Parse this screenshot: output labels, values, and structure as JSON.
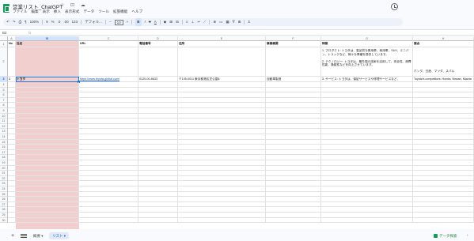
{
  "app": {
    "title": "営業リスト_ChatGPT",
    "title_icons": "☆ ⊡ ☁",
    "menus": [
      "ファイル",
      "編集",
      "表示",
      "挿入",
      "表示形式",
      "データ",
      "ツール",
      "拡張機能",
      "ヘルプ"
    ]
  },
  "toolbar": {
    "undo": "↶",
    "redo": "↷",
    "print": "⎙",
    "paint": "¶",
    "zoom": "100%",
    "currency": "¥",
    "percent": "%",
    "dec_less": ".0",
    "dec_more": ".00",
    "format_123": "123",
    "font": "デフォル...",
    "font_size_minus": "−",
    "font_size": "10",
    "font_size_plus": "+",
    "bold": "B",
    "italic": "I",
    "strike": "S",
    "text_color": "A",
    "fill": "◆",
    "borders": "⊞",
    "merge": "⊟",
    "align": "≡",
    "valign": "⊥",
    "wrap": "↩",
    "rotate": "⟋",
    "link": "⊗",
    "comment": "▭",
    "chart": "▦",
    "filter": "∇",
    "views": "⊞",
    "functions": "Σ"
  },
  "formula_bar": {
    "cell_ref": "B3",
    "fx": "fx"
  },
  "columns": [
    "",
    "A",
    "B",
    "C",
    "D",
    "E",
    "F",
    "G",
    "H"
  ],
  "rows": {
    "r1": {
      "num": "1",
      "cells": [
        "No",
        "社名",
        "URL",
        "電話番号",
        "住所",
        "事業概要",
        "特徴",
        "競合"
      ]
    },
    "r2": {
      "num": "2",
      "cells": [
        "",
        "",
        "",
        "",
        "",
        "",
        "1. プロダクト: トヨタは、高品質な乗用車、商用車、SUV、ミニバン、トラックなど、様々な車種を提供しています。\n\n2. テクノロジー: トヨタは、最先端の技術を活用して、安全性、燃費性能、操縦性などを向上させています。",
        "ホンダ、日産、マツダ、スバル"
      ]
    },
    "r3": {
      "num": "3",
      "cells": [
        "1",
        "トヨタ",
        "https://www.toyota-global.com/",
        "0120-00-8633",
        "〒105-0011 東京都港区芝公園4",
        "自動車製造",
        "3. サービス: トヨタは、保証サービスや修理サービスなど、",
        "Toyota's competitors: Honda, Nissan, Mazda"
      ]
    },
    "empty_row_nums": [
      "4",
      "5",
      "6",
      "7",
      "8",
      "9",
      "10",
      "11",
      "12",
      "13",
      "14",
      "15",
      "16",
      "17",
      "18",
      "19",
      "20",
      "21",
      "22",
      "23",
      "24",
      "25",
      "26",
      "27",
      "28",
      "29",
      "30"
    ]
  },
  "bottom": {
    "add_sheet": "+",
    "sheets": [
      {
        "label": "概要 ▾",
        "active": false
      },
      {
        "label": "リスト ▾",
        "active": true
      }
    ],
    "explore": "データ探索",
    "collapse": "‹"
  },
  "colors": {
    "accent": "#1a73e8",
    "column_fill": "#f2cfcf",
    "brand_green": "#0f9d58"
  }
}
